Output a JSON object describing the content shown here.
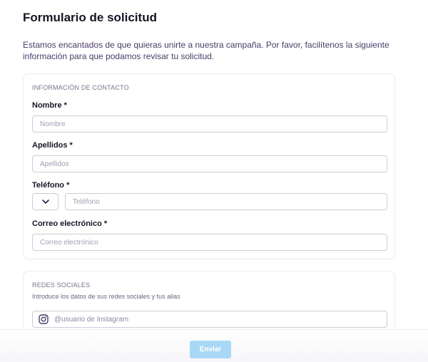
{
  "page": {
    "title": "Formulario de solicitud",
    "intro": "Estamos encantados de que quieras unirte a nuestra campaña. Por favor, facilítenos la siguiente información para que podamos revisar tu solicitud."
  },
  "contact": {
    "section_title": "INFORMACIÓN DE CONTACTO",
    "first_name": {
      "label": "Nombre *",
      "placeholder": "Nombre"
    },
    "last_name": {
      "label": "Apellidos *",
      "placeholder": "Apellidos"
    },
    "phone": {
      "label": "Teléfono *",
      "placeholder": "Teléfono",
      "prefix_icon": "chevron-down-icon"
    },
    "email": {
      "label": "Correo electrónico *",
      "placeholder": "Correo electrónico"
    }
  },
  "social": {
    "section_title": "REDES SOCIALES",
    "help": "Introduce los datos de sus redes sociales y tus alias",
    "instagram": {
      "icon": "instagram-icon",
      "placeholder": "@usuario de Instagram"
    }
  },
  "footer": {
    "submit_label": "Enviar",
    "submit_color": "#a8d8f5"
  }
}
